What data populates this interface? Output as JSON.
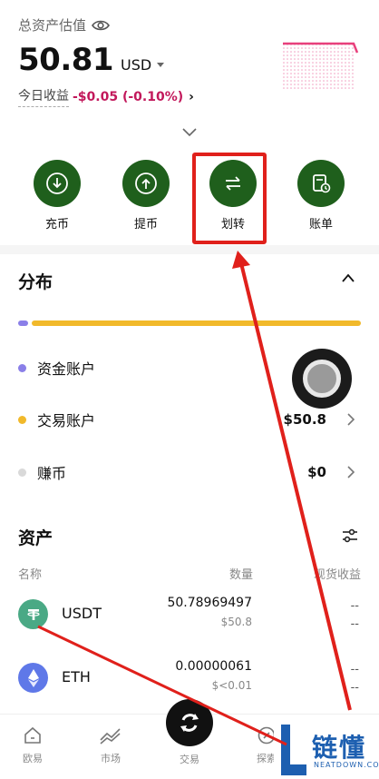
{
  "header": {
    "total_label": "总资产估值",
    "amount": "50.81",
    "currency": "USD",
    "pnl_label": "今日收益",
    "pnl_value": "-$0.05 (-0.10%)"
  },
  "actions": [
    {
      "label": "充币",
      "icon": "deposit-icon"
    },
    {
      "label": "提币",
      "icon": "withdraw-icon"
    },
    {
      "label": "划转",
      "icon": "transfer-icon"
    },
    {
      "label": "账单",
      "icon": "bill-icon"
    }
  ],
  "distribution": {
    "title": "分布",
    "bar_fraction_funding": 0.03,
    "accounts": [
      {
        "name": "资金账户",
        "value": "$",
        "dot_color": "#8a7fe8"
      },
      {
        "name": "交易账户",
        "value": "$50.8",
        "dot_color": "#f1b92b"
      },
      {
        "name": "赚币",
        "value": "$0",
        "dot_color": "#d9d9d9"
      }
    ]
  },
  "assets": {
    "title": "资产",
    "columns": {
      "name": "名称",
      "qty": "数量",
      "pnl": "现货收益"
    },
    "rows": [
      {
        "coin": "USDT",
        "qty": "50.78969497",
        "value": "$50.8",
        "pnl1": "--",
        "pnl2": "--"
      },
      {
        "coin": "ETH",
        "qty": "0.00000061",
        "value": "$<0.01",
        "pnl1": "--",
        "pnl2": "--"
      }
    ]
  },
  "nav": {
    "home": "欧易",
    "market": "市场",
    "trade": "交易",
    "explore": "探索"
  },
  "watermark": {
    "text": "链懂",
    "sub": "NEATDOWN.COM"
  },
  "colors": {
    "action_green": "#1f5f1c",
    "highlight_red": "#e0201b",
    "negative": "#c2185b"
  }
}
